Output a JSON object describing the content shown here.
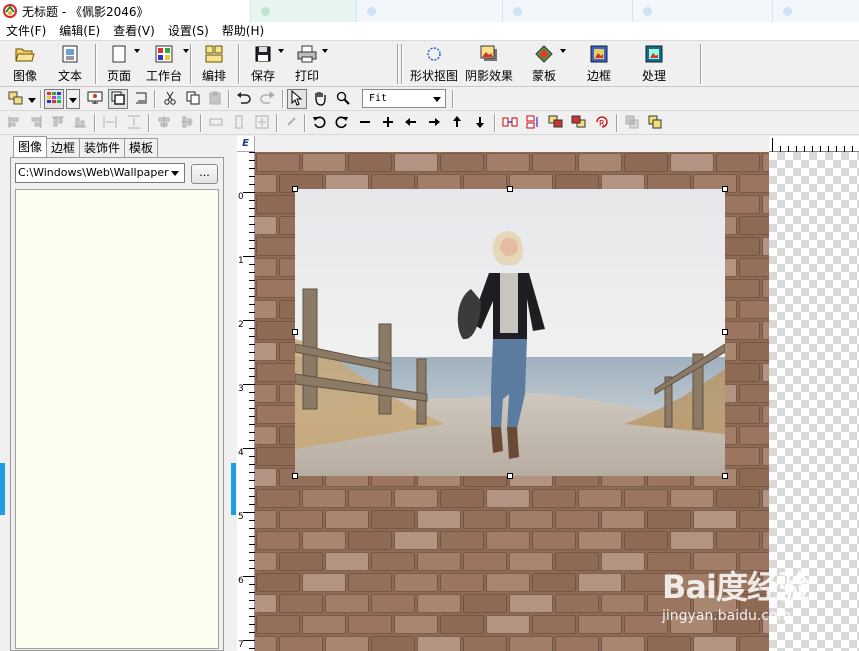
{
  "window": {
    "title": "无标题 - 《佩影2046》",
    "background_tabs": [
      "",
      "",
      "",
      "",
      "",
      ""
    ]
  },
  "menu": [
    "文件(F)",
    "编辑(E)",
    "查看(V)",
    "设置(S)",
    "帮助(H)"
  ],
  "toolbar_main": {
    "image": "图像",
    "text": "文本",
    "page": "页面",
    "workbench": "工作台",
    "arrange": "编排",
    "save": "保存",
    "print": "打印",
    "shape_cutout": "形状抠图",
    "shadow": "阴影效果",
    "mask": "蒙板",
    "frame": "边框",
    "process": "处理"
  },
  "zoom": {
    "value": "Fit"
  },
  "panel": {
    "tabs": [
      "图像",
      "边框",
      "装饰件",
      "模板"
    ],
    "active_tab": 0,
    "path": "C:\\Windows\\Web\\Wallpaper",
    "browse_label": "..."
  },
  "ruler": {
    "corner": "E",
    "vertical_labels": [
      "0",
      "1",
      "2",
      "3",
      "4",
      "5",
      "6",
      "7"
    ]
  },
  "watermark": {
    "brand": "Bai度经验",
    "url": "jingyan.baidu.com"
  },
  "colors": {
    "accent": "#1e9de6",
    "thumb_bg": "#fbfff2",
    "brick": "#8d6a55"
  }
}
